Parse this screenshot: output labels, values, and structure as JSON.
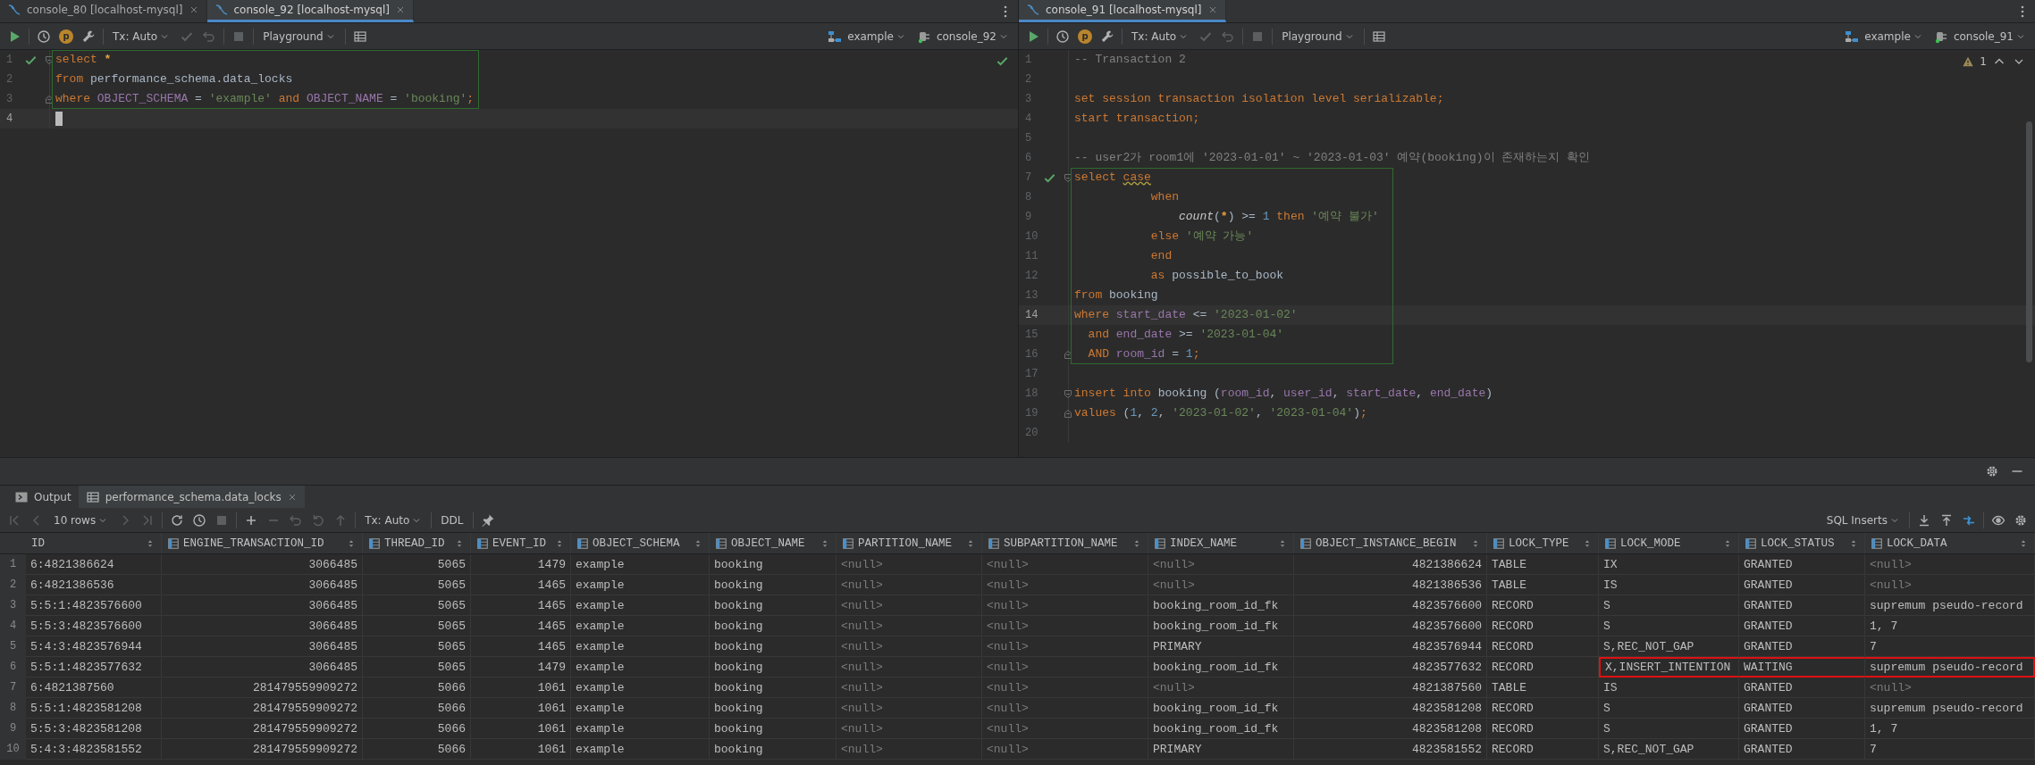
{
  "panes": [
    {
      "tabs": [
        {
          "label": "console_80 [localhost-mysql]",
          "selected": false
        },
        {
          "label": "console_92 [localhost-mysql]",
          "selected": true
        }
      ],
      "toolbar": [
        [
          {
            "kind": "run",
            "disabled": false
          }
        ],
        [
          {
            "kind": "history",
            "disabled": false
          },
          {
            "kind": "explain",
            "label": "p",
            "disabled": false
          },
          {
            "kind": "wrench",
            "disabled": false
          }
        ],
        [
          {
            "kind": "dropdown",
            "label": "Tx: Auto",
            "disabled": false
          },
          {
            "kind": "commit",
            "disabled": true
          },
          {
            "kind": "rollback",
            "disabled": true
          }
        ],
        [
          {
            "kind": "stop",
            "disabled": true
          }
        ],
        [
          {
            "kind": "dropdown",
            "label": "Playground",
            "disabled": false
          }
        ],
        [
          {
            "kind": "grid",
            "disabled": false
          }
        ]
      ],
      "selectors": [
        {
          "kind": "schema",
          "label": "example"
        },
        {
          "kind": "session",
          "label": "console_92"
        }
      ],
      "status": {
        "kind": "ok"
      },
      "scrollable": false,
      "lines": [
        {
          "num": "1",
          "icons": [
            {
              "kind": "check"
            },
            {
              "kind": "fold-start"
            }
          ],
          "in_statement": true,
          "current": false,
          "tokens": [
            {
              "kind": "kw",
              "text": "select "
            },
            {
              "kind": "star",
              "text": "*"
            }
          ]
        },
        {
          "num": "2",
          "in_statement": true,
          "current": false,
          "tokens": [
            {
              "kind": "kw",
              "text": "from "
            },
            {
              "kind": "plain",
              "text": "performance_schema.data_locks"
            }
          ]
        },
        {
          "num": "3",
          "icons": [
            {
              "kind": "fold-end"
            }
          ],
          "in_statement": true,
          "current": false,
          "tokens": [
            {
              "kind": "kw",
              "text": "where "
            },
            {
              "kind": "col",
              "text": "OBJECT_SCHEMA"
            },
            {
              "kind": "plain",
              "text": " = "
            },
            {
              "kind": "str",
              "text": "'example'"
            },
            {
              "kind": "kw",
              "text": " and "
            },
            {
              "kind": "col",
              "text": "OBJECT_NAME"
            },
            {
              "kind": "plain",
              "text": " = "
            },
            {
              "kind": "str",
              "text": "'booking'"
            },
            {
              "kind": "kw",
              "text": ";"
            }
          ]
        },
        {
          "num": "4",
          "in_statement": false,
          "current": true,
          "tokens": [
            {
              "kind": "cursor"
            }
          ]
        }
      ]
    },
    {
      "tabs": [
        {
          "label": "console_91 [localhost-mysql]",
          "selected": true
        }
      ],
      "toolbar": [
        [
          {
            "kind": "run",
            "disabled": false
          }
        ],
        [
          {
            "kind": "history",
            "disabled": false
          },
          {
            "kind": "explain",
            "label": "p",
            "disabled": false
          },
          {
            "kind": "wrench",
            "disabled": false
          }
        ],
        [
          {
            "kind": "dropdown",
            "label": "Tx: Auto",
            "disabled": false
          },
          {
            "kind": "commit",
            "disabled": true
          },
          {
            "kind": "rollback",
            "disabled": true
          }
        ],
        [
          {
            "kind": "stop",
            "disabled": true
          }
        ],
        [
          {
            "kind": "dropdown",
            "label": "Playground",
            "disabled": false
          }
        ],
        [
          {
            "kind": "grid",
            "disabled": false
          }
        ]
      ],
      "selectors": [
        {
          "kind": "schema",
          "label": "example"
        },
        {
          "kind": "session",
          "label": "console_91"
        }
      ],
      "status": {
        "kind": "warnings",
        "count": "1"
      },
      "scrollable": true,
      "lines": [
        {
          "num": "1",
          "in_statement": false,
          "current": false,
          "tokens": [
            {
              "kind": "cmt",
              "text": "-- Transaction 2"
            }
          ]
        },
        {
          "num": "2",
          "current": false
        },
        {
          "num": "3",
          "in_statement": false,
          "current": false,
          "tokens": [
            {
              "kind": "kw",
              "text": "set session transaction isolation level serializable;"
            }
          ]
        },
        {
          "num": "4",
          "in_statement": false,
          "current": false,
          "tokens": [
            {
              "kind": "kw",
              "text": "start transaction;"
            }
          ]
        },
        {
          "num": "5",
          "current": false
        },
        {
          "num": "6",
          "in_statement": false,
          "current": false,
          "tokens": [
            {
              "kind": "cmt",
              "text": "-- user2가 room1에 '2023-01-01' ~ '2023-01-03' 예약(booking)이 존재하는지 확인"
            }
          ]
        },
        {
          "num": "7",
          "icons": [
            {
              "kind": "check"
            },
            {
              "kind": "fold-start"
            }
          ],
          "in_statement": true,
          "current": false,
          "tokens": [
            {
              "kind": "kw",
              "text": "select "
            },
            {
              "kind": "kwwarn",
              "text": "case"
            }
          ]
        },
        {
          "num": "8",
          "in_statement": true,
          "current": false,
          "tokens": [
            {
              "kind": "kw",
              "text": "           when"
            }
          ]
        },
        {
          "num": "9",
          "in_statement": true,
          "current": false,
          "tokens": [
            {
              "kind": "fn",
              "text": "               count"
            },
            {
              "kind": "plain",
              "text": "("
            },
            {
              "kind": "star",
              "text": "*"
            },
            {
              "kind": "plain",
              "text": ") >= "
            },
            {
              "kind": "num",
              "text": "1"
            },
            {
              "kind": "kw",
              "text": " then "
            },
            {
              "kind": "str",
              "text": "'예약 불가'"
            }
          ]
        },
        {
          "num": "10",
          "in_statement": true,
          "current": false,
          "tokens": [
            {
              "kind": "kw",
              "text": "           else "
            },
            {
              "kind": "str",
              "text": "'예약 가능'"
            }
          ]
        },
        {
          "num": "11",
          "in_statement": true,
          "current": false,
          "tokens": [
            {
              "kind": "kw",
              "text": "           end"
            }
          ]
        },
        {
          "num": "12",
          "in_statement": true,
          "current": false,
          "tokens": [
            {
              "kind": "kw",
              "text": "           as "
            },
            {
              "kind": "plain",
              "text": "possible_to_book"
            }
          ]
        },
        {
          "num": "13",
          "in_statement": true,
          "current": false,
          "tokens": [
            {
              "kind": "kw",
              "text": "from "
            },
            {
              "kind": "plain",
              "text": "booking"
            }
          ]
        },
        {
          "num": "14",
          "in_statement": true,
          "current": true,
          "tokens": [
            {
              "kind": "kw",
              "text": "where "
            },
            {
              "kind": "col",
              "text": "start_date"
            },
            {
              "kind": "plain",
              "text": " <= "
            },
            {
              "kind": "str",
              "text": "'2023-01-02'"
            }
          ]
        },
        {
          "num": "15",
          "in_statement": true,
          "current": false,
          "tokens": [
            {
              "kind": "kw",
              "text": "  and "
            },
            {
              "kind": "col",
              "text": "end_date"
            },
            {
              "kind": "plain",
              "text": " >= "
            },
            {
              "kind": "str",
              "text": "'2023-01-04'"
            }
          ]
        },
        {
          "num": "16",
          "icons": [
            {
              "kind": "fold-end"
            }
          ],
          "in_statement": true,
          "current": false,
          "tokens": [
            {
              "kind": "kw",
              "text": "  AND "
            },
            {
              "kind": "col",
              "text": "room_id"
            },
            {
              "kind": "plain",
              "text": " = "
            },
            {
              "kind": "num",
              "text": "1"
            },
            {
              "kind": "kw",
              "text": ";"
            }
          ]
        },
        {
          "num": "17",
          "current": false
        },
        {
          "num": "18",
          "icons": [
            {
              "kind": "fold-start"
            }
          ],
          "in_statement": false,
          "current": false,
          "tokens": [
            {
              "kind": "kw",
              "text": "insert into "
            },
            {
              "kind": "plain",
              "text": "booking ("
            },
            {
              "kind": "col",
              "text": "room_id"
            },
            {
              "kind": "plain",
              "text": ", "
            },
            {
              "kind": "col",
              "text": "user_id"
            },
            {
              "kind": "plain",
              "text": ", "
            },
            {
              "kind": "col",
              "text": "start_date"
            },
            {
              "kind": "plain",
              "text": ", "
            },
            {
              "kind": "col",
              "text": "end_date"
            },
            {
              "kind": "plain",
              "text": ")"
            }
          ]
        },
        {
          "num": "19",
          "icons": [
            {
              "kind": "fold-end"
            }
          ],
          "in_statement": false,
          "current": false,
          "tokens": [
            {
              "kind": "kw",
              "text": "values "
            },
            {
              "kind": "plain",
              "text": "("
            },
            {
              "kind": "num",
              "text": "1"
            },
            {
              "kind": "plain",
              "text": ", "
            },
            {
              "kind": "num",
              "text": "2"
            },
            {
              "kind": "plain",
              "text": ", "
            },
            {
              "kind": "str",
              "text": "'2023-01-02'"
            },
            {
              "kind": "plain",
              "text": ", "
            },
            {
              "kind": "str",
              "text": "'2023-01-04'"
            },
            {
              "kind": "plain",
              "text": ")"
            },
            {
              "kind": "kw",
              "text": ";"
            }
          ]
        },
        {
          "num": "20",
          "current": false
        }
      ]
    }
  ],
  "results": {
    "tabs": [
      {
        "kind": "output",
        "label": "Output",
        "selected": false
      },
      {
        "kind": "table",
        "label": "performance_schema.data_locks",
        "selected": true
      }
    ],
    "toolbar": [
      [
        {
          "kind": "first",
          "disabled": true
        },
        {
          "kind": "prev",
          "disabled": true
        },
        {
          "kind": "dropdown",
          "label": "10 rows",
          "disabled": false
        },
        {
          "kind": "next",
          "disabled": true
        },
        {
          "kind": "last",
          "disabled": true
        }
      ],
      [
        {
          "kind": "refresh",
          "disabled": false
        },
        {
          "kind": "history",
          "disabled": false
        },
        {
          "kind": "stop",
          "disabled": true
        }
      ],
      [
        {
          "kind": "add",
          "disabled": false
        },
        {
          "kind": "remove",
          "disabled": true
        },
        {
          "kind": "rollback",
          "disabled": true
        },
        {
          "kind": "revert",
          "disabled": true
        },
        {
          "kind": "submit",
          "disabled": true
        }
      ],
      [
        {
          "kind": "dropdown",
          "label": "Tx: Auto",
          "disabled": false
        }
      ],
      [
        {
          "kind": "text",
          "label": "DDL",
          "disabled": false
        }
      ],
      [
        {
          "kind": "pin",
          "disabled": false
        }
      ]
    ],
    "toolbar_right": [
      [
        {
          "kind": "dropdown",
          "label": "SQL Inserts",
          "disabled": false
        }
      ],
      [
        {
          "kind": "download",
          "disabled": false
        },
        {
          "kind": "upload",
          "disabled": false
        },
        {
          "kind": "compare",
          "disabled": false
        }
      ],
      [
        {
          "kind": "eye",
          "disabled": false
        },
        {
          "kind": "gear",
          "disabled": false
        }
      ]
    ],
    "columns": [
      {
        "name": "ID",
        "numeric": false,
        "icon": false,
        "flagged": false
      },
      {
        "name": "ENGINE_TRANSACTION_ID",
        "numeric": true,
        "icon": true,
        "flagged": false
      },
      {
        "name": "THREAD_ID",
        "numeric": true,
        "icon": true,
        "flagged": false
      },
      {
        "name": "EVENT_ID",
        "numeric": true,
        "icon": true,
        "flagged": false
      },
      {
        "name": "OBJECT_SCHEMA",
        "numeric": false,
        "icon": true,
        "flagged": false
      },
      {
        "name": "OBJECT_NAME",
        "numeric": false,
        "icon": true,
        "flagged": false
      },
      {
        "name": "PARTITION_NAME",
        "numeric": false,
        "icon": true,
        "flagged": false
      },
      {
        "name": "SUBPARTITION_NAME",
        "numeric": false,
        "icon": true,
        "flagged": false
      },
      {
        "name": "INDEX_NAME",
        "numeric": false,
        "icon": true,
        "flagged": false
      },
      {
        "name": "OBJECT_INSTANCE_BEGIN",
        "numeric": true,
        "icon": true,
        "flagged": false
      },
      {
        "name": "LOCK_TYPE",
        "numeric": false,
        "icon": true,
        "flagged": false
      },
      {
        "name": "LOCK_MODE",
        "numeric": false,
        "icon": true,
        "flagged": true
      },
      {
        "name": "LOCK_STATUS",
        "numeric": false,
        "icon": true,
        "flagged": true
      },
      {
        "name": "LOCK_DATA",
        "numeric": false,
        "icon": true,
        "flagged": true
      }
    ],
    "rows": [
      {
        "num": "1",
        "flagged": false,
        "cells": [
          "6:4821386624",
          "3066485",
          "5065",
          "1479",
          "example",
          "booking",
          {
            "kind": "null",
            "text": "<null>"
          },
          {
            "kind": "null",
            "text": "<null>"
          },
          {
            "kind": "null",
            "text": "<null>"
          },
          "4821386624",
          "TABLE",
          "IX",
          "GRANTED",
          {
            "kind": "null",
            "text": "<null>"
          }
        ]
      },
      {
        "num": "2",
        "flagged": false,
        "cells": [
          "6:4821386536",
          "3066485",
          "5065",
          "1465",
          "example",
          "booking",
          {
            "kind": "null",
            "text": "<null>"
          },
          {
            "kind": "null",
            "text": "<null>"
          },
          {
            "kind": "null",
            "text": "<null>"
          },
          "4821386536",
          "TABLE",
          "IS",
          "GRANTED",
          {
            "kind": "null",
            "text": "<null>"
          }
        ]
      },
      {
        "num": "3",
        "flagged": false,
        "cells": [
          "5:5:1:4823576600",
          "3066485",
          "5065",
          "1465",
          "example",
          "booking",
          {
            "kind": "null",
            "text": "<null>"
          },
          {
            "kind": "null",
            "text": "<null>"
          },
          "booking_room_id_fk",
          "4823576600",
          "RECORD",
          "S",
          "GRANTED",
          "supremum pseudo-record"
        ]
      },
      {
        "num": "4",
        "flagged": false,
        "cells": [
          "5:5:3:4823576600",
          "3066485",
          "5065",
          "1465",
          "example",
          "booking",
          {
            "kind": "null",
            "text": "<null>"
          },
          {
            "kind": "null",
            "text": "<null>"
          },
          "booking_room_id_fk",
          "4823576600",
          "RECORD",
          "S",
          "GRANTED",
          "1, 7"
        ]
      },
      {
        "num": "5",
        "flagged": false,
        "cells": [
          "5:4:3:4823576944",
          "3066485",
          "5065",
          "1465",
          "example",
          "booking",
          {
            "kind": "null",
            "text": "<null>"
          },
          {
            "kind": "null",
            "text": "<null>"
          },
          "PRIMARY",
          "4823576944",
          "RECORD",
          "S,REC_NOT_GAP",
          "GRANTED",
          "7"
        ]
      },
      {
        "num": "6",
        "flagged": true,
        "cells": [
          "5:5:1:4823577632",
          "3066485",
          "5065",
          "1479",
          "example",
          "booking",
          {
            "kind": "null",
            "text": "<null>"
          },
          {
            "kind": "null",
            "text": "<null>"
          },
          "booking_room_id_fk",
          "4823577632",
          "RECORD",
          "X,INSERT_INTENTION",
          "WAITING",
          "supremum pseudo-record"
        ]
      },
      {
        "num": "7",
        "flagged": false,
        "cells": [
          "6:4821387560",
          "281479559909272",
          "5066",
          "1061",
          "example",
          "booking",
          {
            "kind": "null",
            "text": "<null>"
          },
          {
            "kind": "null",
            "text": "<null>"
          },
          {
            "kind": "null",
            "text": "<null>"
          },
          "4821387560",
          "TABLE",
          "IS",
          "GRANTED",
          {
            "kind": "null",
            "text": "<null>"
          }
        ]
      },
      {
        "num": "8",
        "flagged": false,
        "cells": [
          "5:5:1:4823581208",
          "281479559909272",
          "5066",
          "1061",
          "example",
          "booking",
          {
            "kind": "null",
            "text": "<null>"
          },
          {
            "kind": "null",
            "text": "<null>"
          },
          "booking_room_id_fk",
          "4823581208",
          "RECORD",
          "S",
          "GRANTED",
          "supremum pseudo-record"
        ]
      },
      {
        "num": "9",
        "flagged": false,
        "cells": [
          "5:5:3:4823581208",
          "281479559909272",
          "5066",
          "1061",
          "example",
          "booking",
          {
            "kind": "null",
            "text": "<null>"
          },
          {
            "kind": "null",
            "text": "<null>"
          },
          "booking_room_id_fk",
          "4823581208",
          "RECORD",
          "S",
          "GRANTED",
          "1, 7"
        ]
      },
      {
        "num": "10",
        "flagged": false,
        "cells": [
          "5:4:3:4823581552",
          "281479559909272",
          "5066",
          "1061",
          "example",
          "booking",
          {
            "kind": "null",
            "text": "<null>"
          },
          {
            "kind": "null",
            "text": "<null>"
          },
          "PRIMARY",
          "4823581552",
          "RECORD",
          "S,REC_NOT_GAP",
          "GRANTED",
          "7"
        ]
      }
    ]
  }
}
